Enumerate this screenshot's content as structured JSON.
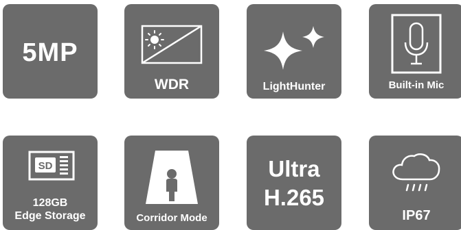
{
  "features": [
    {
      "id": "5mp",
      "text": "5MP",
      "icon": ""
    },
    {
      "id": "wdr",
      "text": "WDR",
      "icon": "wdr-sun-icon"
    },
    {
      "id": "lighthunter",
      "text": "LightHunter",
      "icon": "sparkle-stars-icon"
    },
    {
      "id": "mic",
      "text": "Built-in Mic",
      "icon": "microphone-icon"
    },
    {
      "id": "storage",
      "line1": "128GB",
      "line2": "Edge Storage",
      "icon": "sd-card-icon",
      "card_text": "SD"
    },
    {
      "id": "corridor",
      "text": "Corridor Mode",
      "icon": "corridor-person-icon"
    },
    {
      "id": "h265",
      "line1": "Ultra",
      "line2": "H.265",
      "icon": ""
    },
    {
      "id": "ip67",
      "text": "IP67",
      "icon": "rain-cloud-icon"
    }
  ],
  "colors": {
    "tile_bg": "#6b6b6b",
    "foreground": "#ffffff"
  }
}
